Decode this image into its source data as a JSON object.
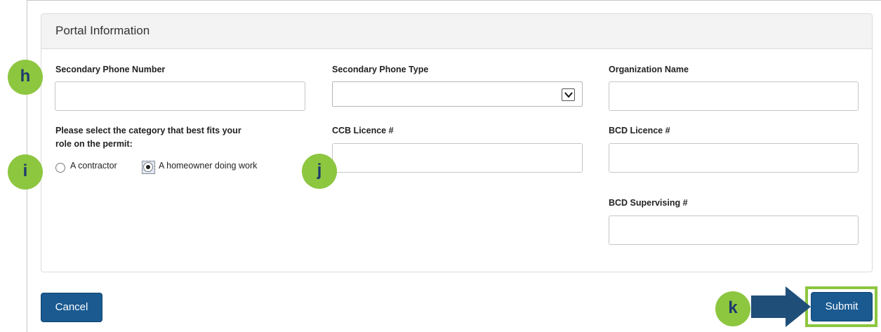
{
  "panel": {
    "title": "Portal Information"
  },
  "fields": {
    "secondary_phone_number": {
      "label": "Secondary Phone Number",
      "value": ""
    },
    "secondary_phone_type": {
      "label": "Secondary Phone Type",
      "value": "",
      "arrow_icon": "chevron-down-icon"
    },
    "organization_name": {
      "label": "Organization Name",
      "value": ""
    },
    "ccb_licence": {
      "label": "CCB Licence #",
      "value": ""
    },
    "bcd_licence": {
      "label": "BCD Licence #",
      "value": ""
    },
    "bcd_supervising": {
      "label": "BCD Supervising #",
      "value": ""
    }
  },
  "role": {
    "question_line1": "Please select the category that best fits your",
    "question_line2": "role on the permit:",
    "options": [
      {
        "label": "A contractor",
        "checked": false
      },
      {
        "label": "A homeowner doing work",
        "checked": true
      }
    ]
  },
  "buttons": {
    "cancel": "Cancel",
    "submit": "Submit"
  },
  "annotations": {
    "markers": [
      "h",
      "i",
      "j",
      "k"
    ],
    "marker_color": "#8dc63f",
    "arrow_color": "#1f4e79"
  },
  "colors": {
    "button": "#1a5a91",
    "highlight": "#8dc63f"
  }
}
